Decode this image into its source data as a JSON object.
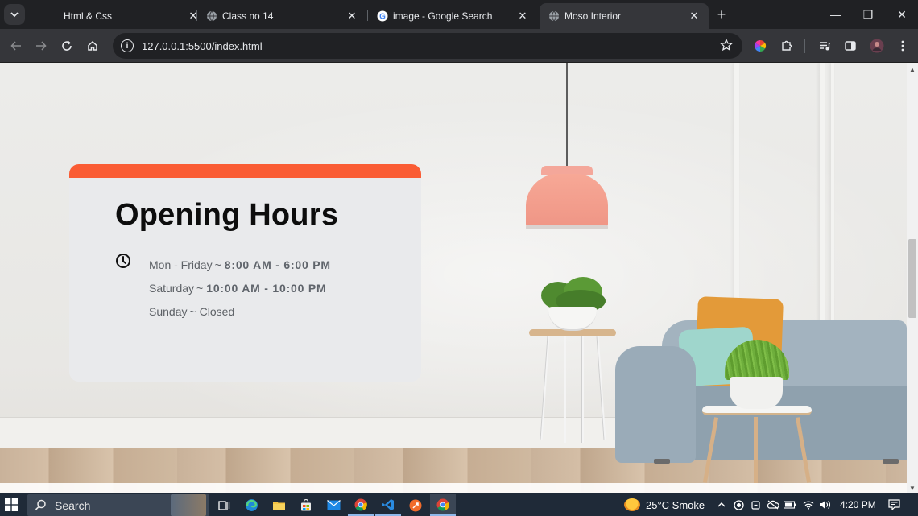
{
  "browser": {
    "tabs": [
      {
        "title": "Html & Css",
        "favicon": "blank-favicon-icon",
        "active": false
      },
      {
        "title": "Class no 14",
        "favicon": "globe-icon",
        "active": false
      },
      {
        "title": "image - Google Search",
        "favicon": "google-g-icon",
        "active": false
      },
      {
        "title": "Moso Interior",
        "favicon": "globe-icon",
        "active": true
      }
    ],
    "new_tab_label": "+",
    "close_label": "✕",
    "url": "127.0.0.1:5500/index.html",
    "window_controls": {
      "minimize": "—",
      "restore": "❐",
      "close": "✕"
    }
  },
  "card": {
    "title": "Opening Hours",
    "accent_color": "#fa5c34",
    "rows": [
      {
        "day": "Mon - Friday",
        "sep": "~",
        "hours": "8:00 AM - 6:00 PM"
      },
      {
        "day": "Saturday",
        "sep": "~",
        "hours": "10:00 AM - 10:00 PM"
      },
      {
        "day": "Sunday",
        "sep": "~",
        "hours": "Closed"
      }
    ]
  },
  "taskbar": {
    "search_label": "Search",
    "weather": {
      "temp": "25°C",
      "condition": "Smoke"
    },
    "time": "4:20 PM"
  }
}
